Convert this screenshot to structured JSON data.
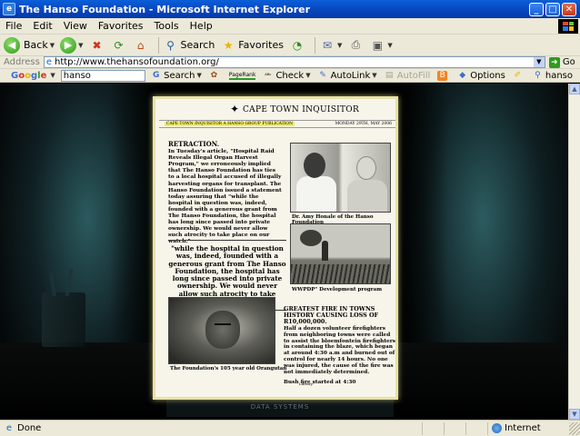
{
  "window": {
    "title": "The Hanso Foundation - Microsoft Internet Explorer",
    "minimize": "_",
    "maximize": "□",
    "close": "✕"
  },
  "menu": {
    "items": [
      "File",
      "Edit",
      "View",
      "Favorites",
      "Tools",
      "Help"
    ]
  },
  "toolbar": {
    "back_label": "Back",
    "search_label": "Search",
    "favorites_label": "Favorites"
  },
  "address": {
    "label": "Address",
    "url": "http://www.thehansofoundation.org/",
    "go_label": "Go"
  },
  "google_toolbar": {
    "logo_parts": [
      "G",
      "o",
      "o",
      "g",
      "l",
      "e"
    ],
    "search_value": "hanso",
    "search_label": "Search",
    "pagerank_label": "PageRank",
    "check_label": "Check",
    "autolink_label": "AutoLink",
    "autofill_label": "AutoFill",
    "options_label": "Options",
    "highlight_term": "hanso"
  },
  "newspaper": {
    "name": "CAPE TOWN INQUISITOR",
    "strip_left": "CAPE TOWN INQUISITOR  A HANSO GROUP PUBLICATION",
    "strip_right": "MONDAY 29TH, MAY 2006",
    "retraction_head": "RETRACTION.",
    "retraction_body": "In Tuesday's article, \"Hospital Raid Reveals Illegal Organ Harvest Program,\" we erroneously implied that The Hanso Foundation has ties to a local hospital accused of illegally harvesting organs for transplant. The Hanso Foundation issued a statement today assuring that \"while the hospital in question was, indeed, founded with a generous grant from The Hanso Foundation, the hospital has long since passed into private ownership. We would never allow such atrocity to take place on our watch.\"",
    "pull_quote": "\"while the hospital in question was, indeed, founded with a generous grant from The Hanso Foundation, the hospital has long since passed into private ownership. We would never allow such atrocity to take place on our watch.\"",
    "caption_doctors": "Dr. Amy Honale of the Hanso Foundation",
    "caption_africa": "WWPDP\" Development program",
    "caption_orangutan": "The Foundation's 105 year old Orangutan",
    "fire_head": "GREATEST FIRE IN TOWNS HISTORY CAUSING LOSS OF R10,000,000.",
    "fire_body": "Half a dozen volunteer firefighters from neighboring towns were called to assist the bloemfontein firefighters in containing the blaze, which began at around 4:30 a.m and burned out of control for nearly 14 hours. No one was injured, the cause of the fire was not immediately determined.",
    "fire_sub": "Bush fire started at 4:30",
    "tail": "Library\""
  },
  "scene": {
    "monitor_brand": "DATA SYSTEMS"
  },
  "status": {
    "text": "Done",
    "zone": "Internet"
  }
}
